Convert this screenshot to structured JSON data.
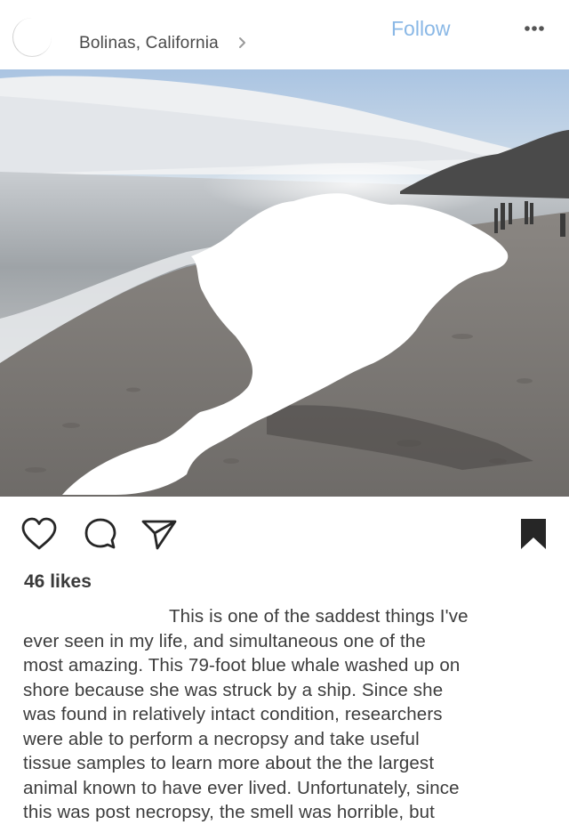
{
  "header": {
    "location": "Bolinas, California",
    "follow_label": "Follow"
  },
  "post": {
    "likes": "46 likes",
    "caption_lines": [
      "This is one of the saddest things I've",
      "ever seen in my life, and simultaneous one of the",
      "most amazing. This 79-foot blue whale washed up on",
      "shore because she was struck by a ship. Since she",
      "was found in relatively intact condition, researchers",
      "were able to perform a necropsy and take useful",
      "tissue samples to learn more about the the largest",
      "animal known to have ever lived. Unfortunately, since",
      "this was post necropsy, the smell was horrible, but"
    ]
  },
  "icons": {
    "more": "more-options-icon",
    "chevron": "chevron-right-icon",
    "like": "heart-icon",
    "comment": "comment-icon",
    "share": "send-icon",
    "save": "bookmark-icon"
  },
  "colors": {
    "follow": "#8ab8e6",
    "text": "#262626"
  }
}
